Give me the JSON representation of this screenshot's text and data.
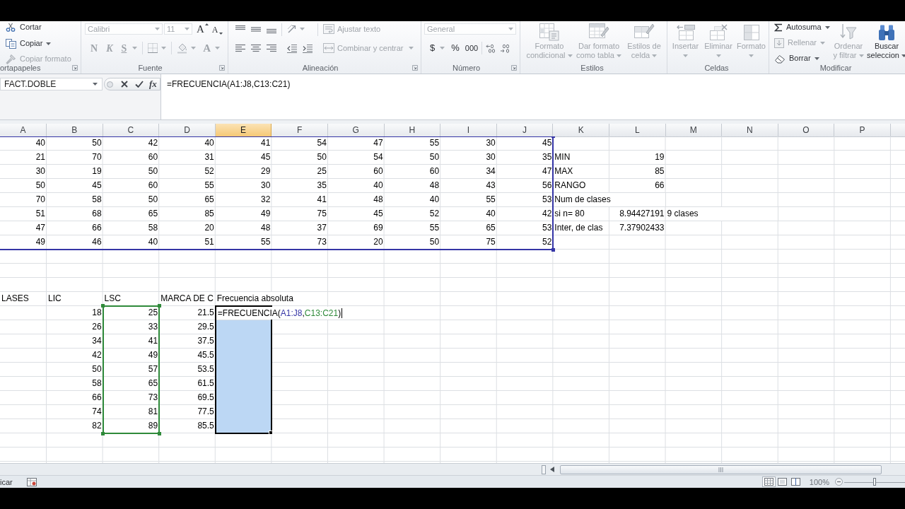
{
  "ribbon": {
    "clipboard": {
      "label": "ortapapeles",
      "buttons": [
        {
          "label": "Cortar",
          "disabled": false
        },
        {
          "label": "Copiar",
          "disabled": false
        },
        {
          "label": "Copiar formato",
          "disabled": true
        }
      ]
    },
    "font": {
      "label": "Fuente",
      "font_name": {
        "value": "Calibri",
        "disabled": true
      },
      "font_size": {
        "value": "11",
        "disabled": true
      },
      "buttons": [
        {
          "label": "A",
          "disabled": false
        },
        {
          "label": "A",
          "disabled": false
        },
        {
          "label": "N",
          "disabled": true
        },
        {
          "label": "K",
          "disabled": true
        },
        {
          "label": "S",
          "disabled": true
        },
        {
          "label": "A",
          "disabled": true
        }
      ]
    },
    "alignment": {
      "label": "Alineación",
      "buttons": [
        {
          "label": "Ajustar texto",
          "disabled": true
        },
        {
          "label": "Combinar y centrar",
          "disabled": true
        }
      ]
    },
    "number": {
      "label": "Número",
      "format": {
        "value": "General",
        "disabled": true
      },
      "buttons": [
        {
          "label": "$",
          "disabled": false
        },
        {
          "label": "%",
          "disabled": false
        },
        {
          "label": "000",
          "disabled": false
        }
      ]
    },
    "styles": {
      "label": "Estilos",
      "buttons": [
        {
          "lines": [
            "Formato",
            "condicional"
          ],
          "disabled": true
        },
        {
          "lines": [
            "Dar formato",
            "como tabla"
          ],
          "disabled": true
        },
        {
          "lines": [
            "Estilos de",
            "celda"
          ],
          "disabled": true
        }
      ]
    },
    "cells": {
      "label": "Celdas",
      "buttons": [
        {
          "label": "Insertar",
          "disabled": true
        },
        {
          "label": "Eliminar",
          "disabled": true
        },
        {
          "label": "Formato",
          "disabled": true
        }
      ]
    },
    "editing": {
      "label": "Modificar",
      "buttons": [
        {
          "kind": "small",
          "lines": [
            "Autosuma"
          ],
          "disabled": false
        },
        {
          "kind": "small",
          "lines": [
            "Rellenar"
          ],
          "disabled": true
        },
        {
          "kind": "small",
          "lines": [
            "Borrar"
          ],
          "disabled": false
        },
        {
          "kind": "large",
          "lines": [
            "Ordenar",
            "y filtrar"
          ],
          "disabled": true
        },
        {
          "kind": "large",
          "lines": [
            "Buscar",
            "seleccion"
          ],
          "disabled": false
        }
      ]
    }
  },
  "formula_bar": {
    "name_box": "FACT.DOBLE",
    "insert_function": "fx",
    "formula": "=FRECUENCIA(A1:J8,C13:C21)"
  },
  "sheet": {
    "columns": [
      {
        "label": "A",
        "selected": false
      },
      {
        "label": "B",
        "selected": false
      },
      {
        "label": "C",
        "selected": false
      },
      {
        "label": "D",
        "selected": false
      },
      {
        "label": "E",
        "selected": true
      },
      {
        "label": "F",
        "selected": false
      },
      {
        "label": "G",
        "selected": false
      },
      {
        "label": "H",
        "selected": false
      },
      {
        "label": "I",
        "selected": false
      },
      {
        "label": "J",
        "selected": false
      },
      {
        "label": "K",
        "selected": false
      },
      {
        "label": "L",
        "selected": false
      },
      {
        "label": "M",
        "selected": false
      },
      {
        "label": "N",
        "selected": false
      },
      {
        "label": "O",
        "selected": false
      },
      {
        "label": "P",
        "selected": false
      }
    ],
    "rows": [
      {
        "cells": [
          {
            "kind": "number",
            "text": "40"
          },
          {
            "kind": "number",
            "text": "50"
          },
          {
            "kind": "number",
            "text": "42"
          },
          {
            "kind": "number",
            "text": "40"
          },
          {
            "kind": "number",
            "text": "41"
          },
          {
            "kind": "number",
            "text": "54"
          },
          {
            "kind": "number",
            "text": "47"
          },
          {
            "kind": "number",
            "text": "55"
          },
          {
            "kind": "number",
            "text": "30"
          },
          {
            "kind": "number",
            "text": "45"
          }
        ]
      },
      {
        "cells": [
          {
            "kind": "number",
            "text": "21"
          },
          {
            "kind": "number",
            "text": "70"
          },
          {
            "kind": "number",
            "text": "60"
          },
          {
            "kind": "number",
            "text": "31"
          },
          {
            "kind": "number",
            "text": "45"
          },
          {
            "kind": "number",
            "text": "50"
          },
          {
            "kind": "number",
            "text": "54"
          },
          {
            "kind": "number",
            "text": "50"
          },
          {
            "kind": "number",
            "text": "30"
          },
          {
            "kind": "number",
            "text": "35"
          },
          {
            "kind": "text",
            "text": "MIN"
          },
          {
            "kind": "number",
            "text": "19"
          }
        ]
      },
      {
        "cells": [
          {
            "kind": "number",
            "text": "30"
          },
          {
            "kind": "number",
            "text": "19"
          },
          {
            "kind": "number",
            "text": "50"
          },
          {
            "kind": "number",
            "text": "52"
          },
          {
            "kind": "number",
            "text": "29"
          },
          {
            "kind": "number",
            "text": "25"
          },
          {
            "kind": "number",
            "text": "60"
          },
          {
            "kind": "number",
            "text": "60"
          },
          {
            "kind": "number",
            "text": "34"
          },
          {
            "kind": "number",
            "text": "47"
          },
          {
            "kind": "text",
            "text": "MAX"
          },
          {
            "kind": "number",
            "text": "85"
          }
        ]
      },
      {
        "cells": [
          {
            "kind": "number",
            "text": "50"
          },
          {
            "kind": "number",
            "text": "45"
          },
          {
            "kind": "number",
            "text": "60"
          },
          {
            "kind": "number",
            "text": "55"
          },
          {
            "kind": "number",
            "text": "30"
          },
          {
            "kind": "number",
            "text": "35"
          },
          {
            "kind": "number",
            "text": "40"
          },
          {
            "kind": "number",
            "text": "48"
          },
          {
            "kind": "number",
            "text": "43"
          },
          {
            "kind": "number",
            "text": "56"
          },
          {
            "kind": "text",
            "text": "RANGO"
          },
          {
            "kind": "number",
            "text": "66"
          }
        ]
      },
      {
        "cells": [
          {
            "kind": "number",
            "text": "70"
          },
          {
            "kind": "number",
            "text": "58"
          },
          {
            "kind": "number",
            "text": "50"
          },
          {
            "kind": "number",
            "text": "65"
          },
          {
            "kind": "number",
            "text": "32"
          },
          {
            "kind": "number",
            "text": "41"
          },
          {
            "kind": "number",
            "text": "48"
          },
          {
            "kind": "number",
            "text": "40"
          },
          {
            "kind": "number",
            "text": "55"
          },
          {
            "kind": "number",
            "text": "53"
          },
          {
            "kind": "text",
            "text": "Num de clases"
          }
        ]
      },
      {
        "cells": [
          {
            "kind": "number",
            "text": "51"
          },
          {
            "kind": "number",
            "text": "68"
          },
          {
            "kind": "number",
            "text": "65"
          },
          {
            "kind": "number",
            "text": "85"
          },
          {
            "kind": "number",
            "text": "49"
          },
          {
            "kind": "number",
            "text": "75"
          },
          {
            "kind": "number",
            "text": "45"
          },
          {
            "kind": "number",
            "text": "52"
          },
          {
            "kind": "number",
            "text": "40"
          },
          {
            "kind": "number",
            "text": "42"
          },
          {
            "kind": "text",
            "text": "si n= 80"
          },
          {
            "kind": "number",
            "text": "8.94427191"
          },
          {
            "kind": "text",
            "text": "9 clases"
          }
        ]
      },
      {
        "cells": [
          {
            "kind": "number",
            "text": "47"
          },
          {
            "kind": "number",
            "text": "66"
          },
          {
            "kind": "number",
            "text": "58"
          },
          {
            "kind": "number",
            "text": "20"
          },
          {
            "kind": "number",
            "text": "48"
          },
          {
            "kind": "number",
            "text": "37"
          },
          {
            "kind": "number",
            "text": "69"
          },
          {
            "kind": "number",
            "text": "55"
          },
          {
            "kind": "number",
            "text": "65"
          },
          {
            "kind": "number",
            "text": "53"
          },
          {
            "kind": "text",
            "text": "Inter, de clas"
          },
          {
            "kind": "number",
            "text": "7.37902433"
          }
        ]
      },
      {
        "cells": [
          {
            "kind": "number",
            "text": "49"
          },
          {
            "kind": "number",
            "text": "46"
          },
          {
            "kind": "number",
            "text": "40"
          },
          {
            "kind": "number",
            "text": "51"
          },
          {
            "kind": "number",
            "text": "55"
          },
          {
            "kind": "number",
            "text": "73"
          },
          {
            "kind": "number",
            "text": "20"
          },
          {
            "kind": "number",
            "text": "50"
          },
          {
            "kind": "number",
            "text": "75"
          },
          {
            "kind": "number",
            "text": "52"
          }
        ]
      },
      {},
      {},
      {},
      {
        "cells": [
          {
            "kind": "text",
            "text": "LASES"
          },
          {
            "kind": "text",
            "text": "LIC"
          },
          {
            "kind": "text",
            "text": "LSC"
          },
          {
            "kind": "text",
            "text": "MARCA DE C"
          },
          {
            "kind": "text",
            "text": "Frecuencia absoluta"
          }
        ]
      },
      {
        "cells": [
          null,
          {
            "kind": "number",
            "text": "18"
          },
          {
            "kind": "number",
            "text": "25"
          },
          {
            "kind": "number",
            "text": "21.5"
          },
          {
            "kind": "editor",
            "parts": [
              {
                "text": "=FRECUENCIA("
              },
              {
                "text": "A1:J8",
                "color": "#3535a6"
              },
              {
                "text": ","
              },
              {
                "text": "C13:C21",
                "color": "#2f8a3a"
              },
              {
                "text": ")"
              }
            ]
          }
        ]
      },
      {
        "cells": [
          null,
          {
            "kind": "number",
            "text": "26"
          },
          {
            "kind": "number",
            "text": "33"
          },
          {
            "kind": "number",
            "text": "29.5"
          }
        ]
      },
      {
        "cells": [
          null,
          {
            "kind": "number",
            "text": "34"
          },
          {
            "kind": "number",
            "text": "41"
          },
          {
            "kind": "number",
            "text": "37.5"
          }
        ]
      },
      {
        "cells": [
          null,
          {
            "kind": "number",
            "text": "42"
          },
          {
            "kind": "number",
            "text": "49"
          },
          {
            "kind": "number",
            "text": "45.5"
          }
        ]
      },
      {
        "cells": [
          null,
          {
            "kind": "number",
            "text": "50"
          },
          {
            "kind": "number",
            "text": "57"
          },
          {
            "kind": "number",
            "text": "53.5"
          }
        ]
      },
      {
        "cells": [
          null,
          {
            "kind": "number",
            "text": "58"
          },
          {
            "kind": "number",
            "text": "65"
          },
          {
            "kind": "number",
            "text": "61.5"
          }
        ]
      },
      {
        "cells": [
          null,
          {
            "kind": "number",
            "text": "66"
          },
          {
            "kind": "number",
            "text": "73"
          },
          {
            "kind": "number",
            "text": "69.5"
          }
        ]
      },
      {
        "cells": [
          null,
          {
            "kind": "number",
            "text": "74"
          },
          {
            "kind": "number",
            "text": "81"
          },
          {
            "kind": "number",
            "text": "77.5"
          }
        ]
      },
      {
        "cells": [
          null,
          {
            "kind": "number",
            "text": "82"
          },
          {
            "kind": "number",
            "text": "89"
          },
          {
            "kind": "number",
            "text": "85.5"
          }
        ]
      },
      {},
      {}
    ]
  },
  "status_bar": {
    "mode": "icar",
    "views": [
      {
        "selected": true
      },
      {
        "selected": false
      },
      {
        "selected": false
      }
    ],
    "zoom": {
      "label": "100%",
      "level": 0.5
    }
  }
}
